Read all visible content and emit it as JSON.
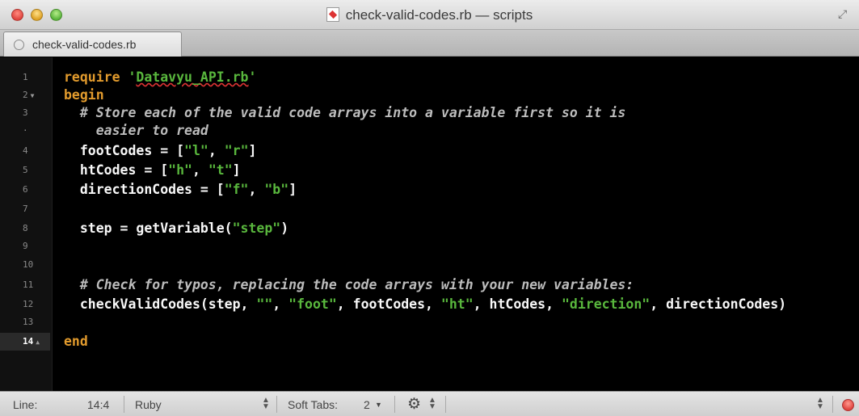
{
  "window": {
    "title": "check-valid-codes.rb — scripts"
  },
  "tabs": [
    {
      "label": "check-valid-codes.rb"
    }
  ],
  "editor": {
    "line_numbers": [
      "1",
      "2",
      "3",
      "·",
      "4",
      "5",
      "6",
      "7",
      "8",
      "9",
      "10",
      "11",
      "12",
      "13",
      "14"
    ],
    "lines": {
      "l1_kw": "require",
      "l1_str_open": " '",
      "l1_file": "Datavyu_API.rb",
      "l1_str_close": "'",
      "l2": "begin",
      "l3": "  # Store each of the valid code arrays into a variable first so it is",
      "l3b": "    easier to read",
      "l4_a": "  footCodes = [",
      "l4_s1": "\"l\"",
      "l4_b": ", ",
      "l4_s2": "\"r\"",
      "l4_c": "]",
      "l5_a": "  htCodes = [",
      "l5_s1": "\"h\"",
      "l5_b": ", ",
      "l5_s2": "\"t\"",
      "l5_c": "]",
      "l6_a": "  directionCodes = [",
      "l6_s1": "\"f\"",
      "l6_b": ", ",
      "l6_s2": "\"b\"",
      "l6_c": "]",
      "l8_a": "  step = getVariable(",
      "l8_s1": "\"step\"",
      "l8_b": ")",
      "l11": "  # Check for typos, replacing the code arrays with your new variables:",
      "l12_a": "  checkValidCodes(step, ",
      "l12_s1": "\"\"",
      "l12_b": ", ",
      "l12_s2": "\"foot\"",
      "l12_c": ", footCodes, ",
      "l12_s3": "\"ht\"",
      "l12_d": ", htCodes, ",
      "l12_s4": "\"direction\"",
      "l12_e": ", directionCodes)",
      "l14": "end"
    }
  },
  "statusbar": {
    "line_label": "Line:",
    "position": "14:4",
    "language": "Ruby",
    "soft_tabs_label": "Soft Tabs:",
    "tab_size": "2"
  },
  "colors": {
    "keyword": "#e29b2d",
    "string": "#59b73d",
    "comment": "#bcbcbc",
    "background": "#000000"
  }
}
